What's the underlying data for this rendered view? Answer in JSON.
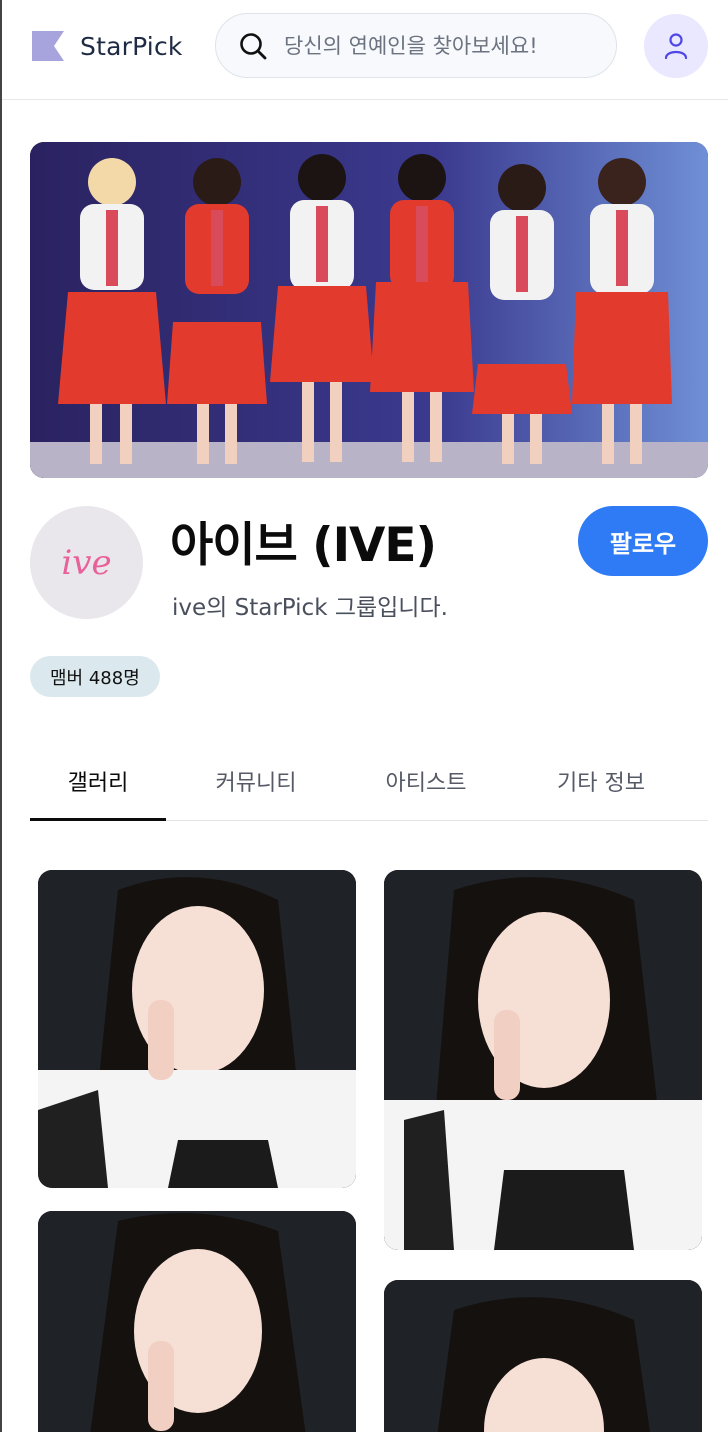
{
  "header": {
    "logo_text": "StarPick",
    "search_placeholder": "당신의 연예인을 찾아보세요!"
  },
  "group": {
    "name": "아이브 (IVE)",
    "description": "ive의 StarPick 그룹입니다.",
    "profile_logo": "ive",
    "follow_label": "팔로우",
    "member_badge": "맴버 488명"
  },
  "tabs": [
    {
      "label": "갤러리",
      "active": true
    },
    {
      "label": "커뮤니티",
      "active": false
    },
    {
      "label": "아티스트",
      "active": false
    },
    {
      "label": "기타 정보",
      "active": false
    }
  ],
  "colors": {
    "accent": "#2f7bf5",
    "badge_bg": "#dbe9ee",
    "avatar_bg": "#e9e8ff",
    "logo_mark": "#a7a4dd"
  },
  "icons": {
    "logo": "flag-logo-icon",
    "search": "search-icon",
    "user": "user-icon"
  }
}
